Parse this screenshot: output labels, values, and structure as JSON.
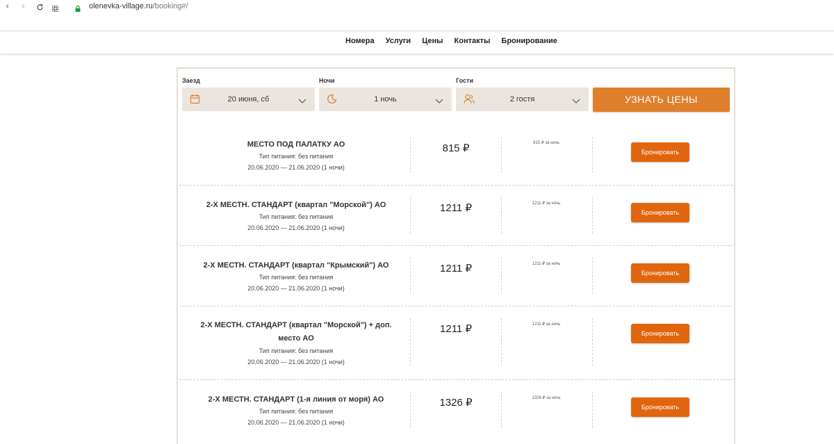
{
  "browser": {
    "url_host": "olenevka-village.ru",
    "url_path": "/booking#/"
  },
  "site_nav": {
    "items": [
      "Номера",
      "Услуги",
      "Цены",
      "Контакты",
      "Бронирование"
    ]
  },
  "search": {
    "checkin_label": "Заезд",
    "checkin_value": "20 июня, сб",
    "nights_label": "Ночи",
    "nights_value": "1 ночь",
    "guests_label": "Гости",
    "guests_value": "2 гостя",
    "submit_label": "УЗНАТЬ ЦЕНЫ"
  },
  "rooms": [
    {
      "name": "МЕСТО ПОД ПАЛАТКУ АО",
      "meal": "Тип питания: без питания",
      "dates": "20.06.2020 — 21.06.2020 (1 ночи)",
      "price": "815 ₽",
      "per_night": "815 ₽ за ночь",
      "button": "Бронировать"
    },
    {
      "name": "2-Х МЕСТН. СТАНДАРТ (квартал \"Морской\") АО",
      "meal": "Тип питания: без питания",
      "dates": "20.06.2020 — 21.06.2020 (1 ночи)",
      "price": "1211 ₽",
      "per_night": "1211 ₽ за ночь",
      "button": "Бронировать"
    },
    {
      "name": "2-Х МЕСТН. СТАНДАРТ (квартал \"Крымский\") АО",
      "meal": "Тип питания: без питания",
      "dates": "20.06.2020 — 21.06.2020 (1 ночи)",
      "price": "1211 ₽",
      "per_night": "1211 ₽ за ночь",
      "button": "Бронировать"
    },
    {
      "name": "2-Х МЕСТН. СТАНДАРТ (квартал \"Морской\") + доп. место АО",
      "meal": "Тип питания: без питания",
      "dates": "20.06.2020 — 21.06.2020 (1 ночи)",
      "price": "1211 ₽",
      "per_night": "1211 ₽ за ночь",
      "button": "Бронировать"
    },
    {
      "name": "2-Х МЕСТН. СТАНДАРТ (1-я линия от моря) АО",
      "meal": "Тип питания: без питания",
      "dates": "20.06.2020 — 21.06.2020 (1 ночи)",
      "price": "1326 ₽",
      "per_night": "1326 ₽ за ночь",
      "button": "Бронировать"
    }
  ],
  "colors": {
    "accent": "#df7f2c",
    "book_button": "#e0650e",
    "field_bg": "#ebe5df",
    "panel_border": "#e6ddd3"
  }
}
